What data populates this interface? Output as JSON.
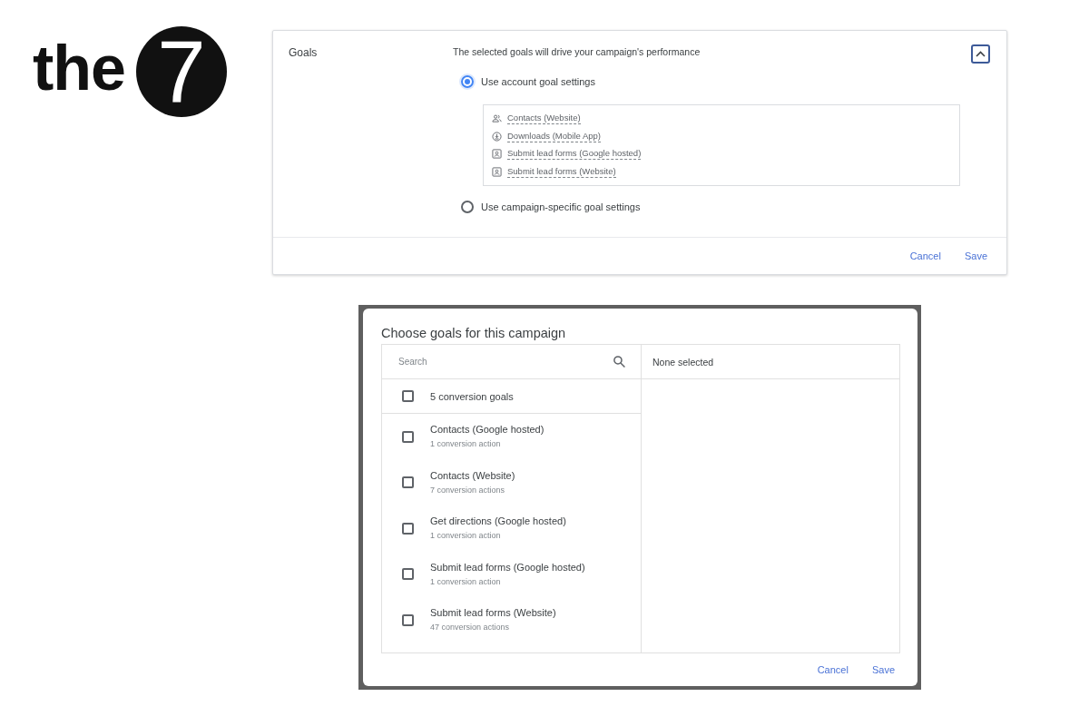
{
  "logo": {
    "text": "the",
    "mark": "7"
  },
  "goals_card": {
    "title": "Goals",
    "description": "The selected goals will drive your campaign's performance",
    "expanded": true,
    "options": [
      {
        "label": "Use account goal settings",
        "selected": true,
        "goals": [
          {
            "kind": "contacts",
            "label": "Contacts (Website)"
          },
          {
            "kind": "download",
            "label": "Downloads (Mobile App)"
          },
          {
            "kind": "form",
            "label": "Submit lead forms (Google hosted)"
          },
          {
            "kind": "form",
            "label": "Submit lead forms (Website)"
          }
        ]
      },
      {
        "label": "Use campaign-specific goal settings",
        "selected": false
      }
    ],
    "buttons": [
      "Cancel",
      "Save"
    ]
  },
  "dialog": {
    "title": "Choose goals for this campaign",
    "search": {
      "placeholder": "Search"
    },
    "selected_summary": "None selected",
    "select_all": {
      "label": "5 conversion goals",
      "checked": false
    },
    "goals": [
      {
        "name": "Contacts (Google hosted)",
        "detail": "1 conversion action",
        "checked": false
      },
      {
        "name": "Contacts (Website)",
        "detail": "7 conversion actions",
        "checked": false
      },
      {
        "name": "Get directions (Google hosted)",
        "detail": "1 conversion action",
        "checked": false
      },
      {
        "name": "Submit lead forms (Google hosted)",
        "detail": "1 conversion action",
        "checked": false
      },
      {
        "name": "Submit lead forms (Website)",
        "detail": "47 conversion actions",
        "checked": false
      }
    ],
    "buttons": [
      "Cancel",
      "Save"
    ]
  }
}
